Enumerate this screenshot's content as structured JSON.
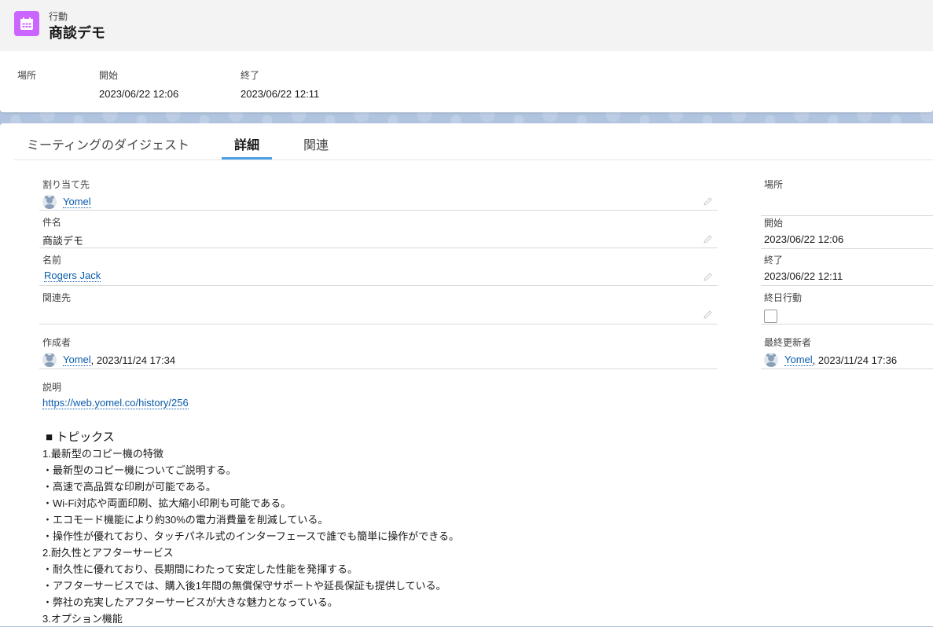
{
  "header": {
    "entity_label": "行動",
    "title": "商談デモ",
    "icon": "calendar-icon",
    "icon_color": "#cb65ff"
  },
  "highlights": [
    {
      "label": "場所",
      "value": ""
    },
    {
      "label": "開始",
      "value": "2023/06/22 12:06"
    },
    {
      "label": "終了",
      "value": "2023/06/22 12:11"
    }
  ],
  "tabs": [
    {
      "label": "ミーティングのダイジェスト",
      "active": false
    },
    {
      "label": "詳細",
      "active": true
    },
    {
      "label": "関連",
      "active": false
    }
  ],
  "details_left": {
    "assigned": {
      "label": "割り当て先",
      "value": "Yomel"
    },
    "subject": {
      "label": "件名",
      "value": "商談デモ"
    },
    "name": {
      "label": "名前",
      "value": "Rogers Jack"
    },
    "related_to": {
      "label": "関連先",
      "value": ""
    },
    "created_by": {
      "label": "作成者",
      "user": "Yomel",
      "date": ", 2023/11/24 17:34"
    }
  },
  "details_right": {
    "location": {
      "label": "場所",
      "value": ""
    },
    "start": {
      "label": "開始",
      "value": "2023/06/22 12:06"
    },
    "end": {
      "label": "終了",
      "value": "2023/06/22 12:11"
    },
    "all_day": {
      "label": "終日行動",
      "checked": false
    },
    "modified_by": {
      "label": "最終更新者",
      "user": "Yomel",
      "date": ", 2023/11/24 17:36"
    }
  },
  "description": {
    "label": "説明",
    "url": "https://web.yomel.co/history/256",
    "lines": [
      "■ トピックス",
      "1.最新型のコピー機の特徴",
      "・最新型のコピー機についてご説明する。",
      "・高速で高品質な印刷が可能である。",
      "・Wi-Fi対応や両面印刷、拡大縮小印刷も可能である。",
      "・エコモード機能により約30%の電力消費量を削減している。",
      "・操作性が優れており、タッチパネル式のインターフェースで誰でも簡単に操作ができる。",
      "2.耐久性とアフターサービス",
      "・耐久性に優れており、長期間にわたって安定した性能を発揮する。",
      "・アフターサービスでは、購入後1年間の無償保守サポートや延長保証も提供している。",
      "・弊社の充実したアフターサービスが大きな魅力となっている。",
      "3.オプション機能"
    ]
  },
  "colors": {
    "link": "#0b5cab",
    "tab_active_border": "#4aa0e6",
    "background": "#b0c4df"
  }
}
